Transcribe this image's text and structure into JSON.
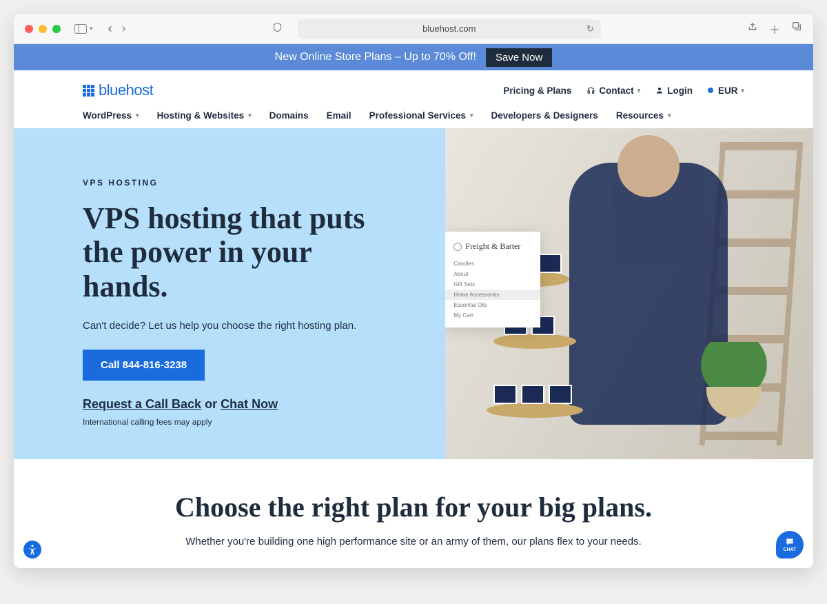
{
  "browser": {
    "url": "bluehost.com"
  },
  "promo": {
    "text": "New Online Store Plans – Up to 70% Off!",
    "button": "Save Now"
  },
  "header": {
    "logo": "bluehost",
    "utility": {
      "pricing": "Pricing & Plans",
      "contact": "Contact",
      "login": "Login",
      "currency": "EUR"
    },
    "nav": {
      "wordpress": "WordPress",
      "hosting": "Hosting & Websites",
      "domains": "Domains",
      "email": "Email",
      "professional": "Professional Services",
      "developers": "Developers & Designers",
      "resources": "Resources"
    }
  },
  "hero": {
    "eyebrow": "VPS HOSTING",
    "title": "VPS hosting that puts the power in your hands.",
    "subtitle": "Can't decide? Let us help you choose the right hosting plan.",
    "cta": "Call 844-816-3238",
    "request": "Request a Call Back",
    "or": " or ",
    "chat": "Chat Now",
    "fineprint": "International calling fees may apply",
    "panel": {
      "brand": "Freight & Barter",
      "items": {
        "candles": "Candles",
        "about": "About",
        "gift": "Gift Sets",
        "home": "Home Accessories",
        "essential": "Essential Oils",
        "cart": "My Cart"
      }
    }
  },
  "plans": {
    "title": "Choose the right plan for your big plans.",
    "subtitle": "Whether you're building one high performance site or an army of them, our plans flex to your needs."
  },
  "chat_label": "CHAT"
}
